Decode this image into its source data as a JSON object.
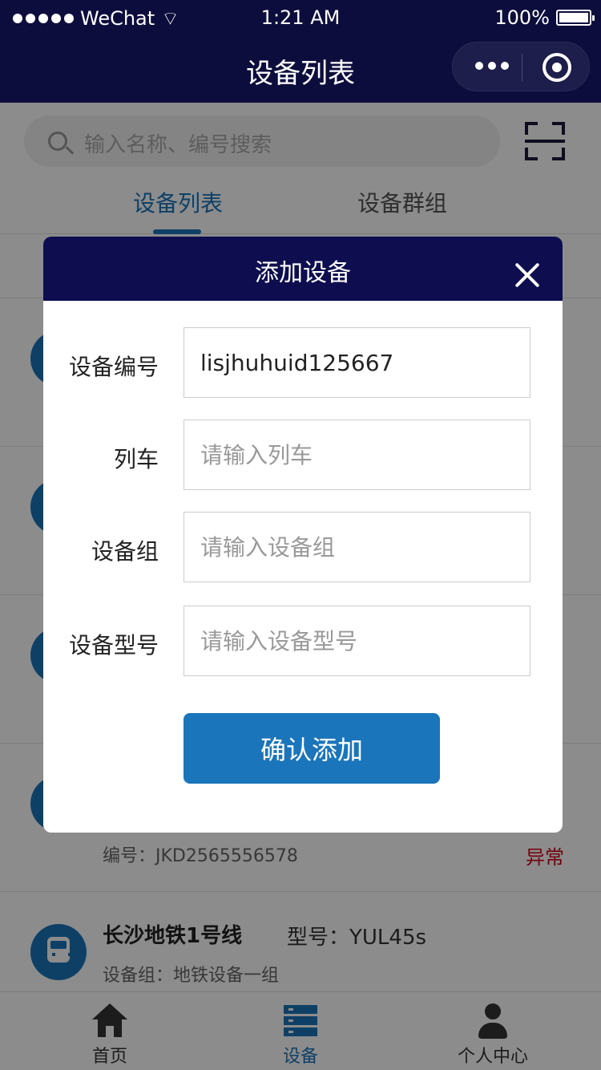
{
  "status_bar": {
    "carrier": "WeChat",
    "time": "1:21 AM",
    "battery": "100%"
  },
  "nav": {
    "title": "设备列表"
  },
  "search": {
    "placeholder": "输入名称、编号搜索"
  },
  "tabs": [
    {
      "label": "设备列表",
      "active": true
    },
    {
      "label": "设备群组",
      "active": false
    }
  ],
  "list": {
    "row4": {
      "code_label": "编号：",
      "code": "JKD2565556578",
      "status": "异常"
    },
    "row5": {
      "title": "长沙地铁1号线",
      "model_label": "型号：",
      "model": "YUL45s",
      "group_label": "设备组：",
      "group": "地铁设备一组"
    }
  },
  "modal": {
    "title": "添加设备",
    "fields": [
      {
        "label": "设备编号",
        "value": "lisjhuhuid125667",
        "placeholder": ""
      },
      {
        "label": "列车",
        "value": "",
        "placeholder": "请输入列车"
      },
      {
        "label": "设备组",
        "value": "",
        "placeholder": "请输入设备组"
      },
      {
        "label": "设备型号",
        "value": "",
        "placeholder": "请输入设备型号"
      }
    ],
    "confirm_label": "确认添加"
  },
  "tabbar": [
    {
      "label": "首页",
      "icon": "home-icon",
      "active": false
    },
    {
      "label": "设备",
      "icon": "device-icon",
      "active": true
    },
    {
      "label": "个人中心",
      "icon": "user-icon",
      "active": false
    }
  ],
  "colors": {
    "brand_dark": "#0d0d4f",
    "accent": "#1b75bb",
    "alert": "#d0021b"
  }
}
